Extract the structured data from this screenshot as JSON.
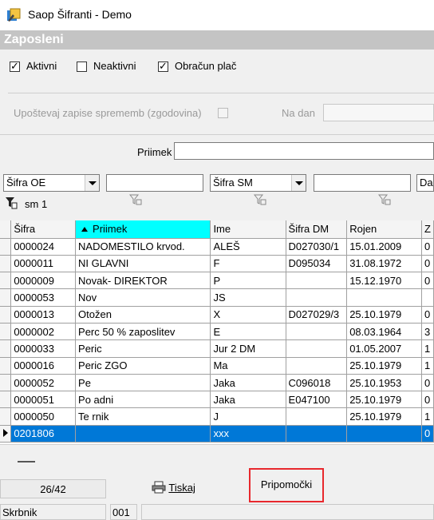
{
  "window": {
    "title": "Saop Šifranti - Demo"
  },
  "section": {
    "title": "Zaposleni"
  },
  "filters": {
    "aktivni": {
      "label": "Aktivni",
      "checked": true
    },
    "neaktivni": {
      "label": "Neaktivni",
      "checked": false
    },
    "obracun": {
      "label": "Obračun plač",
      "checked": true
    },
    "history": {
      "label": "Upoštevaj zapise sprememb (zgodovina)",
      "checked": false
    },
    "na_dan": {
      "label": "Na dan",
      "value": ""
    },
    "priimek": {
      "label": "Priimek",
      "value": ""
    }
  },
  "combos": {
    "sifra_oe": "Šifra OE",
    "sifra_oe_text": "",
    "sifra_sm": "Šifra SM",
    "sifra_sm_text": "",
    "datum_partial": "Da"
  },
  "grouping": {
    "label": "sm 1"
  },
  "grid": {
    "columns": [
      "Šifra",
      "Priimek",
      "Ime",
      "Šifra DM",
      "Rojen",
      "Z"
    ],
    "sorted_column": "Priimek",
    "rows": [
      [
        "0000024",
        "NADOMESTILO krvod.",
        "ALEŠ",
        "D027030/1",
        "15.01.2009",
        "0"
      ],
      [
        "0000011",
        "NI GLAVNI",
        "F",
        "D095034",
        "31.08.1972",
        "0"
      ],
      [
        "0000009",
        "Novak- DIREKTOR",
        "P",
        "",
        "15.12.1970",
        "0"
      ],
      [
        "0000053",
        "Nov",
        "JS",
        "",
        "",
        ""
      ],
      [
        "0000013",
        "Otožen",
        "X",
        "D027029/3",
        "25.10.1979",
        "0"
      ],
      [
        "0000002",
        "Perc 50 % zaposlitev",
        "E",
        "",
        "08.03.1964",
        "3"
      ],
      [
        "0000033",
        "Peric",
        "Jur 2 DM",
        "",
        "01.05.2007",
        "1"
      ],
      [
        "0000016",
        "Peric ZGO",
        "Ma",
        "",
        "25.10.1979",
        "1"
      ],
      [
        "0000052",
        "Pe",
        "Jaka",
        "C096018",
        "25.10.1953",
        "0"
      ],
      [
        "0000051",
        "Po adni",
        "Jaka",
        "E047100",
        "25.10.1979",
        "0"
      ],
      [
        "0000050",
        "Te rnik",
        "J",
        "",
        "25.10.1979",
        "1"
      ],
      [
        "0201806",
        "",
        "xxx",
        "",
        "",
        "0"
      ]
    ],
    "selected_row": 11
  },
  "footer": {
    "record_count": "26/42",
    "print_label": "Tiskaj",
    "tools_label": "Pripomočki"
  },
  "status": {
    "user": "Skrbnik",
    "code": "001",
    "extra": ""
  },
  "colors": {
    "sorted_header": "#00ffff",
    "selection": "#0078d7",
    "highlight_border": "#e8282d"
  }
}
